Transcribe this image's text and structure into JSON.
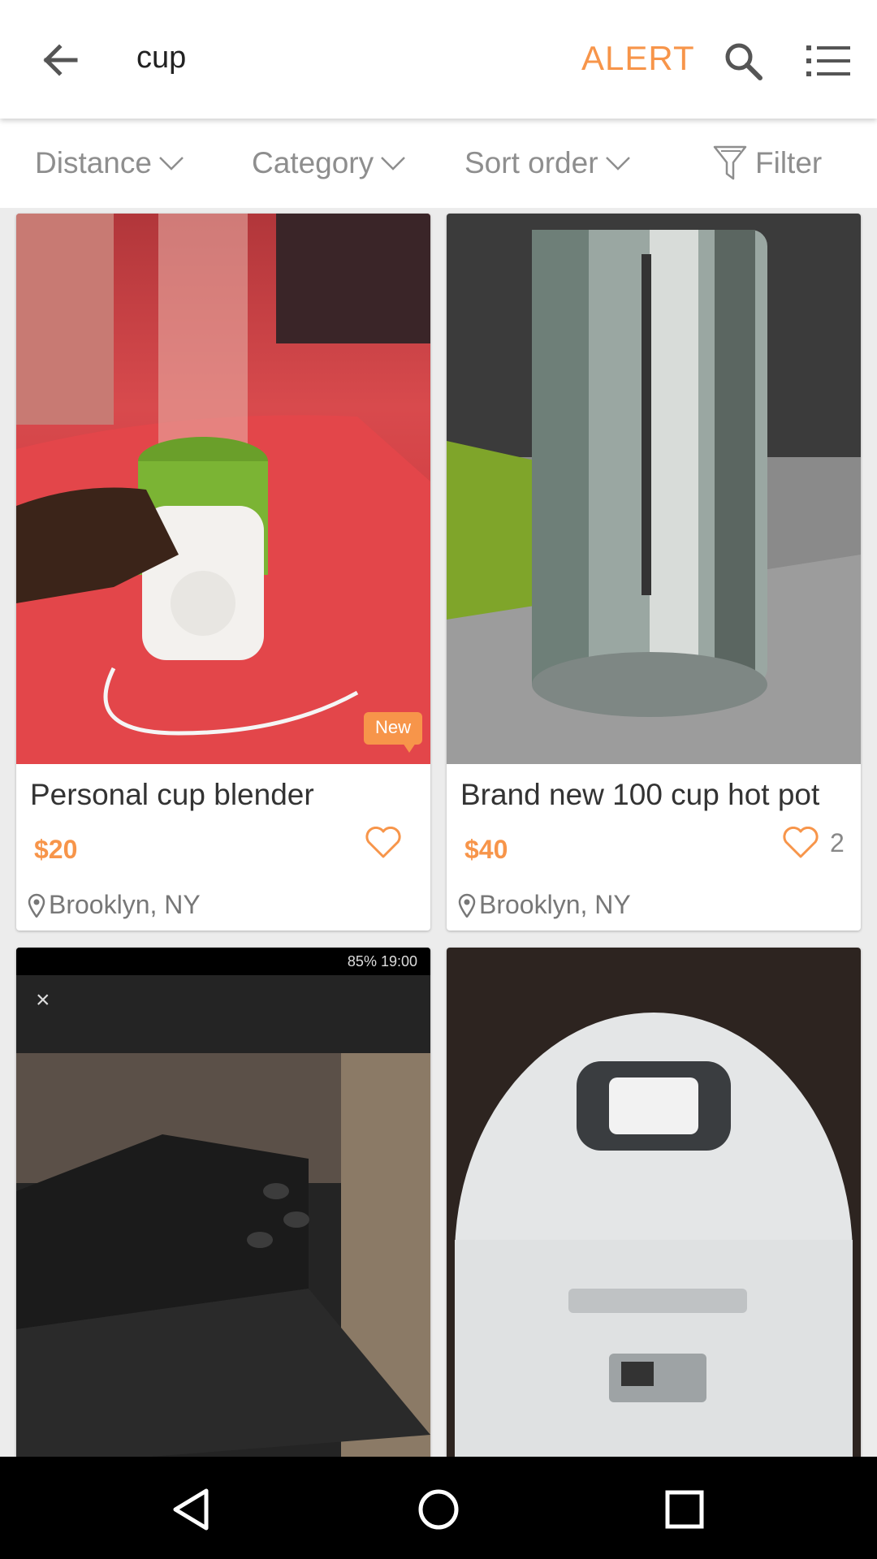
{
  "search": {
    "query": "cup",
    "alert_label": "ALERT"
  },
  "filters": [
    {
      "label": "Distance"
    },
    {
      "label": "Category"
    },
    {
      "label": "Sort order"
    },
    {
      "label": "Filter"
    }
  ],
  "listings": [
    {
      "title": "Personal cup blender",
      "price": "$20",
      "location": "Brooklyn, NY",
      "badge": "New",
      "favorites": ""
    },
    {
      "title": "Brand new 100 cup hot pot",
      "price": "$40",
      "location": "Brooklyn, NY",
      "badge": "",
      "favorites": "2"
    },
    {
      "status_bar": "85% 19:00",
      "close": "×"
    },
    {}
  ],
  "colors": {
    "accent": "#f7954a",
    "muted": "#8e8e8e"
  },
  "icons": [
    "back-arrow-icon",
    "search-icon",
    "list-view-icon",
    "chevron-down-icon",
    "filter-funnel-icon",
    "heart-icon",
    "location-pin-icon",
    "nav-back-icon",
    "nav-home-icon",
    "nav-recents-icon"
  ]
}
